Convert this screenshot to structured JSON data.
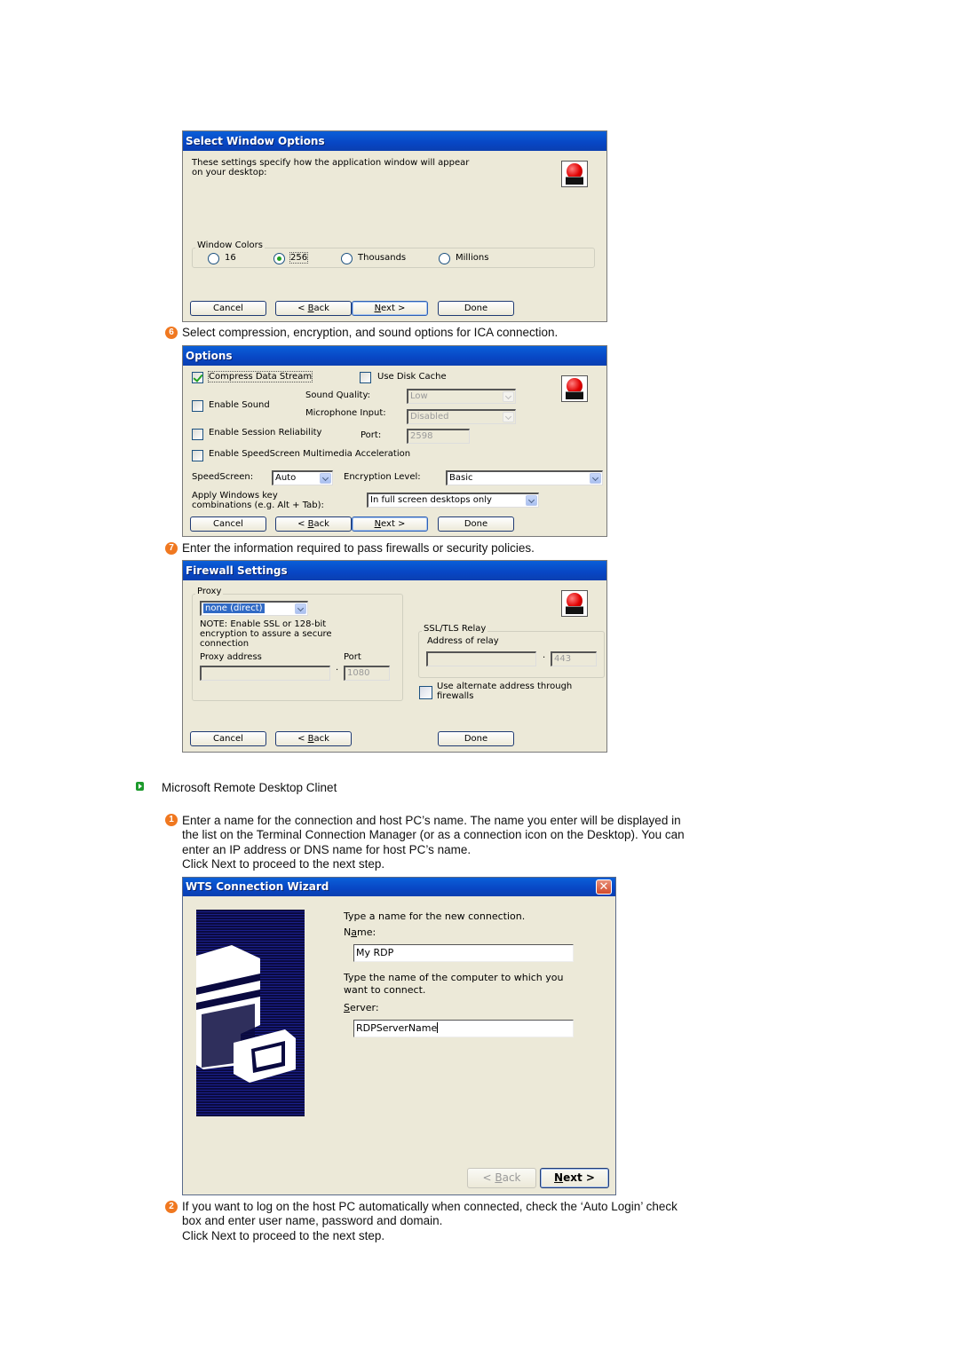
{
  "select_window_options": {
    "title": "Select Window Options",
    "description_line1": "These settings specify how the application window will appear",
    "description_line2": "on your desktop:",
    "window_colors": {
      "legend": "Window Colors",
      "options": [
        "16",
        "256",
        "Thousands",
        "Millions"
      ],
      "selected": "256"
    },
    "buttons": {
      "cancel": "Cancel",
      "back_prefix": "< ",
      "back_u": "B",
      "back_rest": "ack",
      "next_u": "N",
      "next_rest": "ext >",
      "done": "Done"
    }
  },
  "step6": {
    "number": "6",
    "text": "Select compression, encryption, and sound options for ICA connection."
  },
  "options": {
    "title": "Options",
    "compress_data_stream": {
      "label": "Compress Data Stream",
      "checked": true
    },
    "use_disk_cache": {
      "label": "Use Disk Cache",
      "checked": false
    },
    "enable_sound": {
      "label": "Enable Sound",
      "checked": false
    },
    "sound_quality": {
      "label": "Sound Quality:",
      "value": "Low"
    },
    "microphone_input": {
      "label": "Microphone Input:",
      "value": "Disabled"
    },
    "enable_session_reliability": {
      "label": "Enable Session Reliability",
      "checked": false
    },
    "port": {
      "label": "Port:",
      "value": "2598"
    },
    "enable_speedscreen_mma": {
      "label": "Enable SpeedScreen Multimedia Acceleration",
      "checked": false
    },
    "speedscreen": {
      "label": "SpeedScreen:",
      "value": "Auto"
    },
    "encryption_level": {
      "label": "Encryption Level:",
      "value": "Basic"
    },
    "windows_key": {
      "label_line1": "Apply Windows key",
      "label_line2": "combinations (e.g. Alt + Tab):",
      "value": "In full screen desktops only"
    },
    "buttons": {
      "cancel": "Cancel",
      "back_prefix": "< ",
      "back_u": "B",
      "back_rest": "ack",
      "next_u": "N",
      "next_rest": "ext >",
      "done": "Done"
    }
  },
  "step7": {
    "number": "7",
    "text": "Enter the information required to pass firewalls or security policies."
  },
  "firewall": {
    "title": "Firewall Settings",
    "proxy_legend": "Proxy",
    "proxy_value": "none (direct)",
    "note_line1": "NOTE: Enable SSL or 128-bit",
    "note_line2": "encryption to assure a secure",
    "note_line3": "connection",
    "proxy_address_label": "Proxy address",
    "proxy_address_value": "",
    "port_label": "Port",
    "port_value": "1080",
    "ssl_legend": "SSL/TLS Relay",
    "relay_address_label": "Address of relay",
    "relay_address_value": "",
    "relay_port_value": "443",
    "alternate_address": {
      "label_line1": "Use alternate address through",
      "label_line2": "firewalls",
      "checked": false
    },
    "separator": "·",
    "buttons": {
      "cancel": "Cancel",
      "back_prefix": "< ",
      "back_u": "B",
      "back_rest": "ack",
      "done": "Done"
    }
  },
  "section_rdc": {
    "title": "Microsoft Remote Desktop Clinet"
  },
  "step1": {
    "number": "1",
    "line1": "Enter a name for the connection and host PC’s name. The name you enter will be displayed in",
    "line2": "the list on the Terminal Connection Manager (or as a connection icon on the Desktop). You can",
    "line3": "enter an IP address or DNS name for host PC’s name.",
    "line4": "Click Next to proceed to the next step."
  },
  "wts_wizard": {
    "title": "WTS Connection Wizard",
    "close_glyph": "✕",
    "name_prompt": "Type a name for the new connection.",
    "name_label_pre": "N",
    "name_label_u": "a",
    "name_label_post": "me:",
    "name_value": "My RDP",
    "server_prompt_line1": "Type the name of the computer to which you",
    "server_prompt_line2": "want to connect.",
    "server_label_u": "S",
    "server_label_post": "erver:",
    "server_value": "RDPServerName",
    "back_prefix": "< ",
    "back_u": "B",
    "back_rest": "ack",
    "next_u": "N",
    "next_rest": "ext >"
  },
  "step2": {
    "number": "2",
    "line1": "If you want to log on the host PC automatically when connected, check the ‘Auto Login’ check",
    "line2": "box and enter user name, password and domain.",
    "line3": "Click Next to proceed to the next step."
  },
  "colors": {
    "titlebar": "#0846c4",
    "dialog_bg": "#ece9d8",
    "step_number": "#f07820",
    "section_bullet": "#1c9a2c",
    "radio_selected": "#21a121",
    "selection": "#316ac5"
  }
}
